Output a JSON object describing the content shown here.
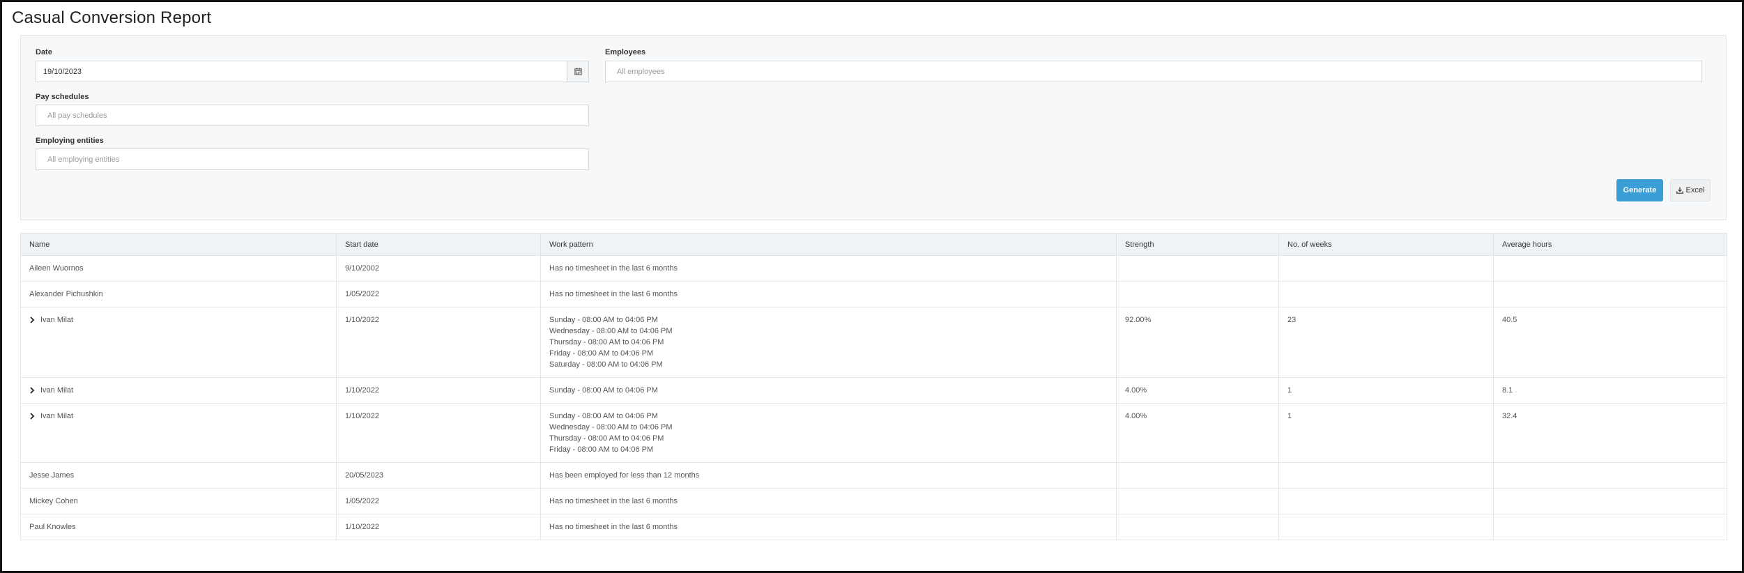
{
  "page": {
    "title": "Casual Conversion Report"
  },
  "filters": {
    "date": {
      "label": "Date",
      "value": "19/10/2023"
    },
    "employees": {
      "label": "Employees",
      "placeholder": "All employees"
    },
    "pay_schedules": {
      "label": "Pay schedules",
      "placeholder": "All pay schedules"
    },
    "employing_entities": {
      "label": "Employing entities",
      "placeholder": "All employing entities"
    },
    "generate_label": "Generate",
    "excel_label": "Excel",
    "icons": {
      "calendar": "calendar-icon",
      "download": "download-icon"
    }
  },
  "table": {
    "columns": [
      "Name",
      "Start date",
      "Work pattern",
      "Strength",
      "No. of weeks",
      "Average hours"
    ],
    "rows": [
      {
        "name": "Aileen Wuornos",
        "start_date": "9/10/2002",
        "work_pattern": [
          "Has no timesheet in the last 6 months"
        ],
        "strength": "",
        "weeks": "",
        "avg_hours": "",
        "expandable": false
      },
      {
        "name": "Alexander Pichushkin",
        "start_date": "1/05/2022",
        "work_pattern": [
          "Has no timesheet in the last 6 months"
        ],
        "strength": "",
        "weeks": "",
        "avg_hours": "",
        "expandable": false
      },
      {
        "name": "Ivan Milat",
        "start_date": "1/10/2022",
        "work_pattern": [
          "Sunday - 08:00 AM to 04:06 PM",
          "Wednesday - 08:00 AM to 04:06 PM",
          "Thursday - 08:00 AM to 04:06 PM",
          "Friday - 08:00 AM to 04:06 PM",
          "Saturday - 08:00 AM to 04:06 PM"
        ],
        "strength": "92.00%",
        "weeks": "23",
        "avg_hours": "40.5",
        "expandable": true
      },
      {
        "name": "Ivan Milat",
        "start_date": "1/10/2022",
        "work_pattern": [
          "Sunday - 08:00 AM to 04:06 PM"
        ],
        "strength": "4.00%",
        "weeks": "1",
        "avg_hours": "8.1",
        "expandable": true
      },
      {
        "name": "Ivan Milat",
        "start_date": "1/10/2022",
        "work_pattern": [
          "Sunday - 08:00 AM to 04:06 PM",
          "Wednesday - 08:00 AM to 04:06 PM",
          "Thursday - 08:00 AM to 04:06 PM",
          "Friday - 08:00 AM to 04:06 PM"
        ],
        "strength": "4.00%",
        "weeks": "1",
        "avg_hours": "32.4",
        "expandable": true
      },
      {
        "name": "Jesse James",
        "start_date": "20/05/2023",
        "work_pattern": [
          "Has been employed for less than 12 months"
        ],
        "strength": "",
        "weeks": "",
        "avg_hours": "",
        "expandable": false
      },
      {
        "name": "Mickey Cohen",
        "start_date": "1/05/2022",
        "work_pattern": [
          "Has no timesheet in the last 6 months"
        ],
        "strength": "",
        "weeks": "",
        "avg_hours": "",
        "expandable": false
      },
      {
        "name": "Paul Knowles",
        "start_date": "1/10/2022",
        "work_pattern": [
          "Has no timesheet in the last 6 months"
        ],
        "strength": "",
        "weeks": "",
        "avg_hours": "",
        "expandable": false
      }
    ]
  }
}
